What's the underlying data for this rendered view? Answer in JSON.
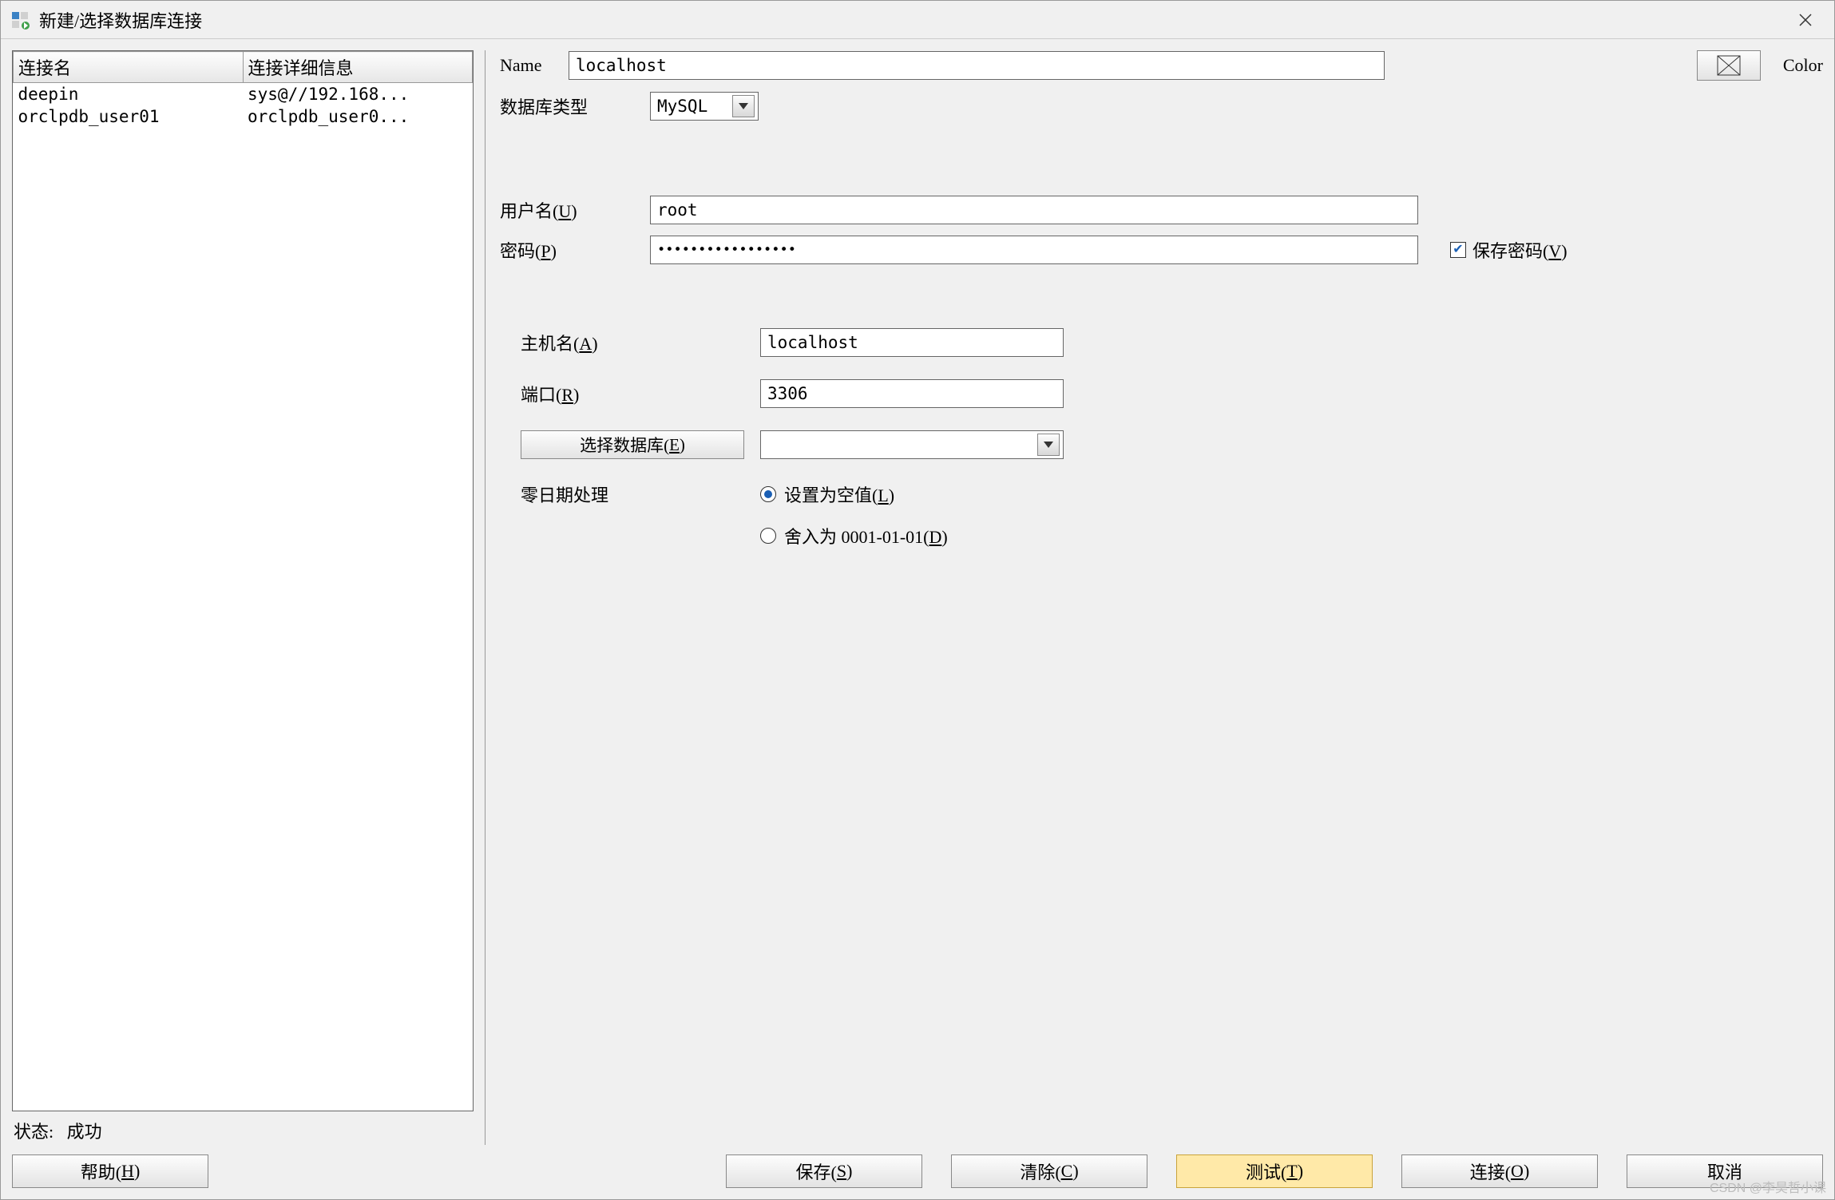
{
  "window": {
    "title": "新建/选择数据库连接"
  },
  "left": {
    "headers": {
      "name": "连接名",
      "details": "连接详细信息"
    },
    "rows": [
      {
        "name": "deepin",
        "details": "sys@//192.168..."
      },
      {
        "name": "orclpdb_user01",
        "details": "orclpdb_user0..."
      }
    ],
    "status_label": "状态:",
    "status_value": "成功"
  },
  "form": {
    "name_label": "Name",
    "name_value": "localhost",
    "color_label": "Color",
    "dbtype_label": "数据库类型",
    "dbtype_value": "MySQL",
    "user_label": "用户名(",
    "user_mn": "U",
    "user_label_tail": ")",
    "user_value": "root",
    "pass_label": "密码(",
    "pass_mn": "P",
    "pass_label_tail": ")",
    "pass_dots": "•••••••••••••••••",
    "savepass_label": "保存密码(",
    "savepass_mn": "V",
    "savepass_tail": ")",
    "host_label": "主机名(",
    "host_mn": "A",
    "host_label_tail": ")",
    "host_value": "localhost",
    "port_label": "端口(",
    "port_mn": "R",
    "port_label_tail": ")",
    "port_value": "3306",
    "selectdb_btn": "选择数据库(",
    "selectdb_mn": "E",
    "selectdb_tail": ")",
    "zerodate_label": "零日期处理",
    "radio_null": "设置为空值(",
    "radio_null_mn": "L",
    "radio_null_tail": ")",
    "radio_round": "舍入为 0001-01-01(",
    "radio_round_mn": "D",
    "radio_round_tail": ")"
  },
  "buttons": {
    "help": "帮助(",
    "help_mn": "H",
    "help_tail": ")",
    "save": "保存(",
    "save_mn": "S",
    "save_tail": ")",
    "clear": "清除(",
    "clear_mn": "C",
    "clear_tail": ")",
    "test": "测试(",
    "test_mn": "T",
    "test_tail": ")",
    "connect": "连接(",
    "connect_mn": "O",
    "connect_tail": ")",
    "cancel": "取消"
  },
  "watermark": "CSDN @李昊哲小课"
}
